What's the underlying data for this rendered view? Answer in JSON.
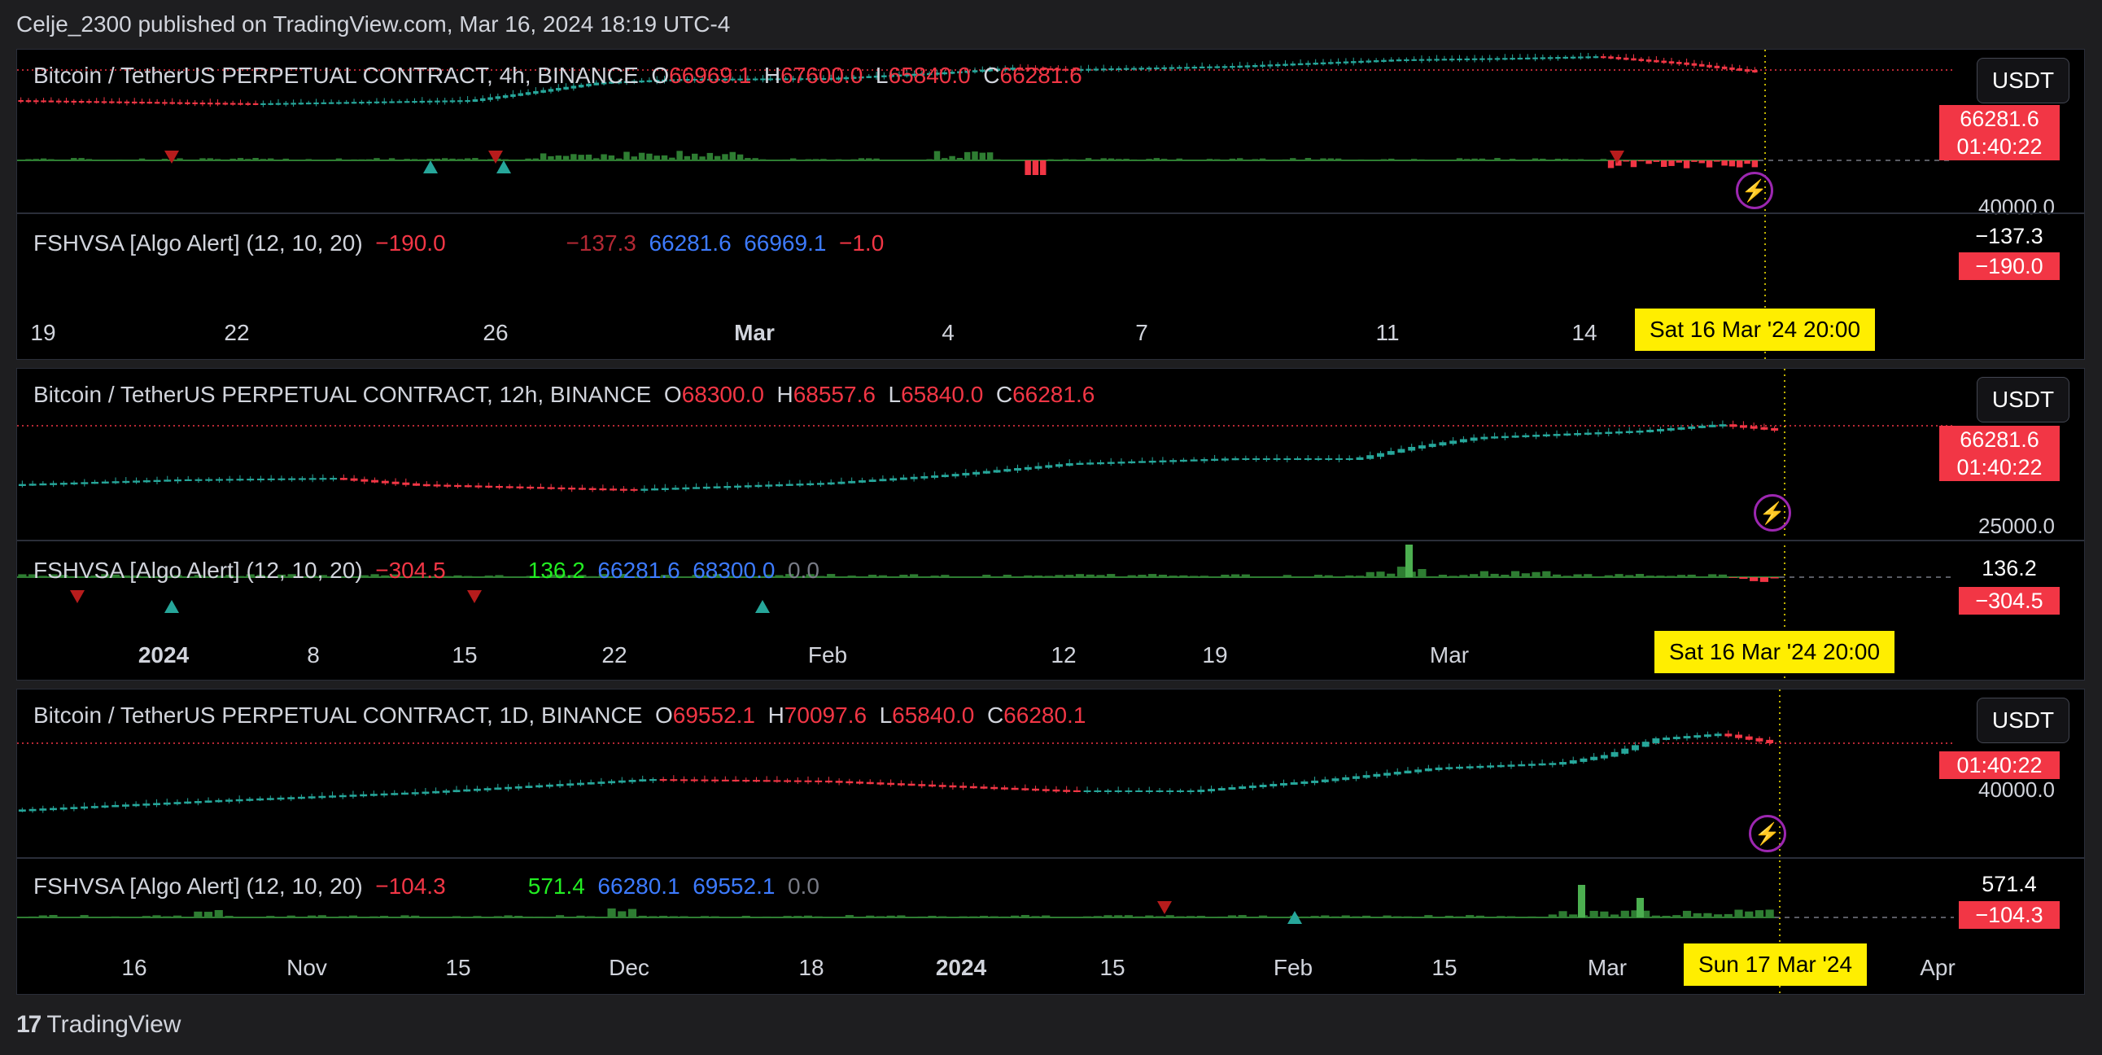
{
  "caption": "Celje_2300 published on TradingView.com, Mar 16, 2024 18:19 UTC-4",
  "colors": {
    "up": "#26a69a",
    "down": "#f23645",
    "vol_up": "#2e7d32",
    "vol_bright": "#4caf50",
    "crosshair_tag": "#ffee00",
    "alert": "#9c27b0"
  },
  "panels": [
    {
      "symbol": "Bitcoin / TetherUS PERPETUAL CONTRACT, 4h, BINANCE",
      "o_label": "O",
      "o": "66969.1",
      "h_label": "H",
      "h": "67600.0",
      "l_label": "L",
      "l": "65840.0",
      "c_label": "C",
      "c": "66281.6",
      "currency": "USDT",
      "price_tag": "66281.6",
      "countdown": "01:40:22",
      "axis_value": "40000.0",
      "indicator": {
        "name": "FSHVSA [Algo Alert] (12, 10, 20)",
        "v1": "−190.0",
        "v2": "−137.3",
        "v3": "66281.6",
        "v4": "66969.1",
        "v5": "−1.0",
        "axis_top": "−137.3",
        "tag": "−190.0"
      },
      "x_labels": [
        "19",
        "22",
        "26",
        "Mar",
        "4",
        "7",
        "11",
        "14"
      ],
      "crosshair_label": "Sat 16 Mar '24   20:00"
    },
    {
      "symbol": "Bitcoin / TetherUS PERPETUAL CONTRACT, 12h, BINANCE",
      "o_label": "O",
      "o": "68300.0",
      "h_label": "H",
      "h": "68557.6",
      "l_label": "L",
      "l": "65840.0",
      "c_label": "C",
      "c": "66281.6",
      "currency": "USDT",
      "price_tag": "66281.6",
      "countdown": "01:40:22",
      "axis_value": "25000.0",
      "indicator": {
        "name": "FSHVSA [Algo Alert] (12, 10, 20)",
        "v1": "−304.5",
        "v2": "136.2",
        "v3": "66281.6",
        "v4": "68300.0",
        "v5": "0.0",
        "axis_top": "136.2",
        "tag": "−304.5"
      },
      "x_labels": [
        "2024",
        "8",
        "15",
        "22",
        "Feb",
        "12",
        "19",
        "Mar"
      ],
      "crosshair_label": "Sat 16 Mar '24   20:00"
    },
    {
      "symbol": "Bitcoin / TetherUS PERPETUAL CONTRACT, 1D, BINANCE",
      "o_label": "O",
      "o": "69552.1",
      "h_label": "H",
      "h": "70097.6",
      "l_label": "L",
      "l": "65840.0",
      "c_label": "C",
      "c": "66280.1",
      "currency": "USDT",
      "price_tag": "",
      "countdown": "01:40:22",
      "axis_value": "40000.0",
      "indicator": {
        "name": "FSHVSA [Algo Alert] (12, 10, 20)",
        "v1": "−104.3",
        "v2": "571.4",
        "v3": "66280.1",
        "v4": "69552.1",
        "v5": "0.0",
        "axis_top": "571.4",
        "tag": "−104.3"
      },
      "x_labels": [
        "16",
        "Nov",
        "15",
        "Dec",
        "18",
        "2024",
        "15",
        "Feb",
        "15",
        "Mar",
        "Apr"
      ],
      "crosshair_label": "Sun 17 Mar '24"
    }
  ],
  "brand": "TradingView"
}
